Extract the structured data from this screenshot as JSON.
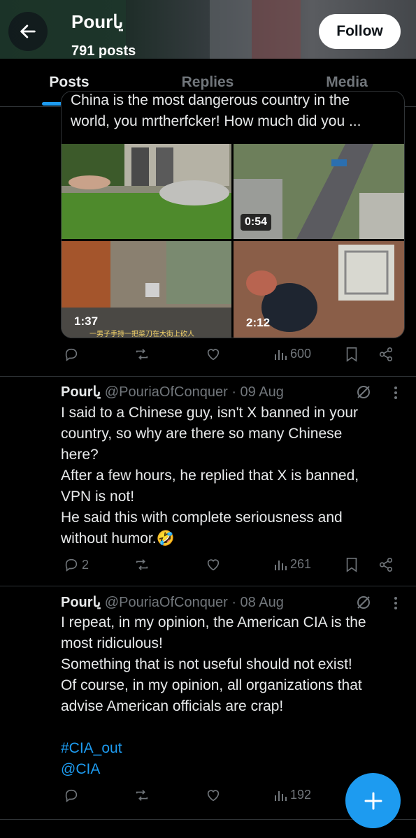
{
  "header": {
    "name": "Pourيا",
    "post_count": "791 posts",
    "follow_label": "Follow"
  },
  "tabs": [
    {
      "label": "Posts",
      "active": true
    },
    {
      "label": "Replies",
      "active": false
    },
    {
      "label": "Media",
      "active": false
    }
  ],
  "quote": {
    "text_line1": "China is the most dangerous country in the",
    "text_line2": "world, you mrtherfcker! How much did you ...",
    "media": [
      {
        "duration": ""
      },
      {
        "duration": "0:54"
      },
      {
        "duration": "1:37",
        "subtitle": "一男子手持一把菜刀在大街上砍人"
      },
      {
        "duration": "2:12"
      }
    ]
  },
  "post1_actions": {
    "views": "600"
  },
  "posts": [
    {
      "name": "Pourيا",
      "handle": "@PouriaOfConquer",
      "date": "· 09 Aug",
      "lines": [
        "I said to a Chinese guy, isn't X banned in your",
        "country, so why are there so many Chinese",
        "here?",
        "After a few hours, he replied that X is banned,",
        "VPN is not!",
        "He said this with complete seriousness and",
        "without humor.🤣"
      ],
      "replies": "2",
      "views": "261"
    },
    {
      "name": "Pourيا",
      "handle": "@PouriaOfConquer",
      "date": "· 08 Aug",
      "lines": [
        "I repeat, in my opinion, the American CIA is the",
        "most ridiculous!",
        "Something that is not useful should not exist!",
        "Of course, in my opinion, all organizations that",
        "advise American officials are crap!"
      ],
      "hashtag": "#CIA_out",
      "mention": "@CIA",
      "views": "192"
    }
  ],
  "colors": {
    "accent": "#1d9bf0",
    "muted": "#71767b",
    "text": "#e7e9ea",
    "border": "#2f3336"
  }
}
